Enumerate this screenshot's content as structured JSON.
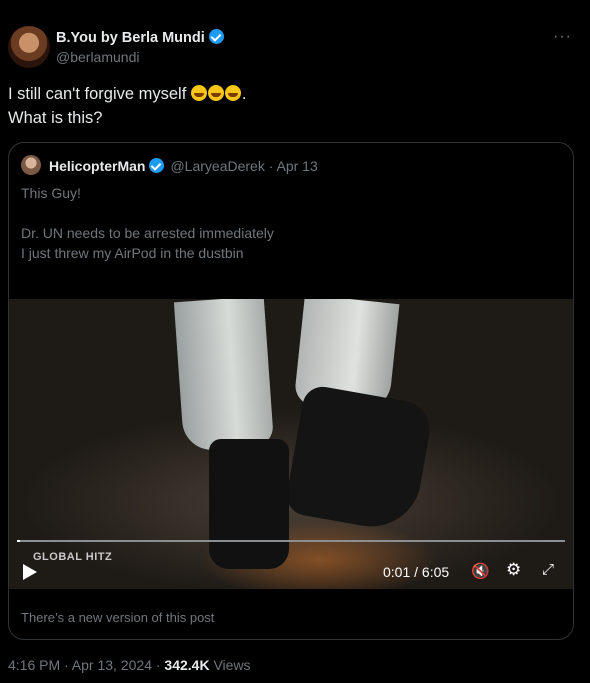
{
  "post": {
    "author_name": "B.You by Berla Mundi",
    "author_handle": "@berlamundi",
    "more_label": "···",
    "text_line1": "I still can't forgive myself",
    "text_line1_end": ".",
    "text_line2": "What is this?",
    "timestamp": "4:16 PM · Apr 13, 2024 · ",
    "views_count": "342.4K",
    "views_label": "Views"
  },
  "quoted": {
    "author_name": "HelicopterMan",
    "author_handle": "@LaryeaDerek · Apr 13",
    "text": "This Guy!\n\nDr. UN needs to be arrested immediately\nI just threw my AirPod in the dustbin",
    "new_version_notice": "There’s a new version of this post"
  },
  "video": {
    "watermark": "GLOBAL HITZ",
    "time": "0:01 / 6:05",
    "progress": 0.003
  },
  "icons": {
    "play": "play-icon",
    "mute": "mute-icon",
    "settings": "gear-icon",
    "fullscreen": "fullscreen-icon",
    "verified": "verified-badge-icon"
  },
  "colors": {
    "background": "#000000",
    "text": "#e7e9ea",
    "muted": "#71767b",
    "verified": "#1d9bf0"
  }
}
